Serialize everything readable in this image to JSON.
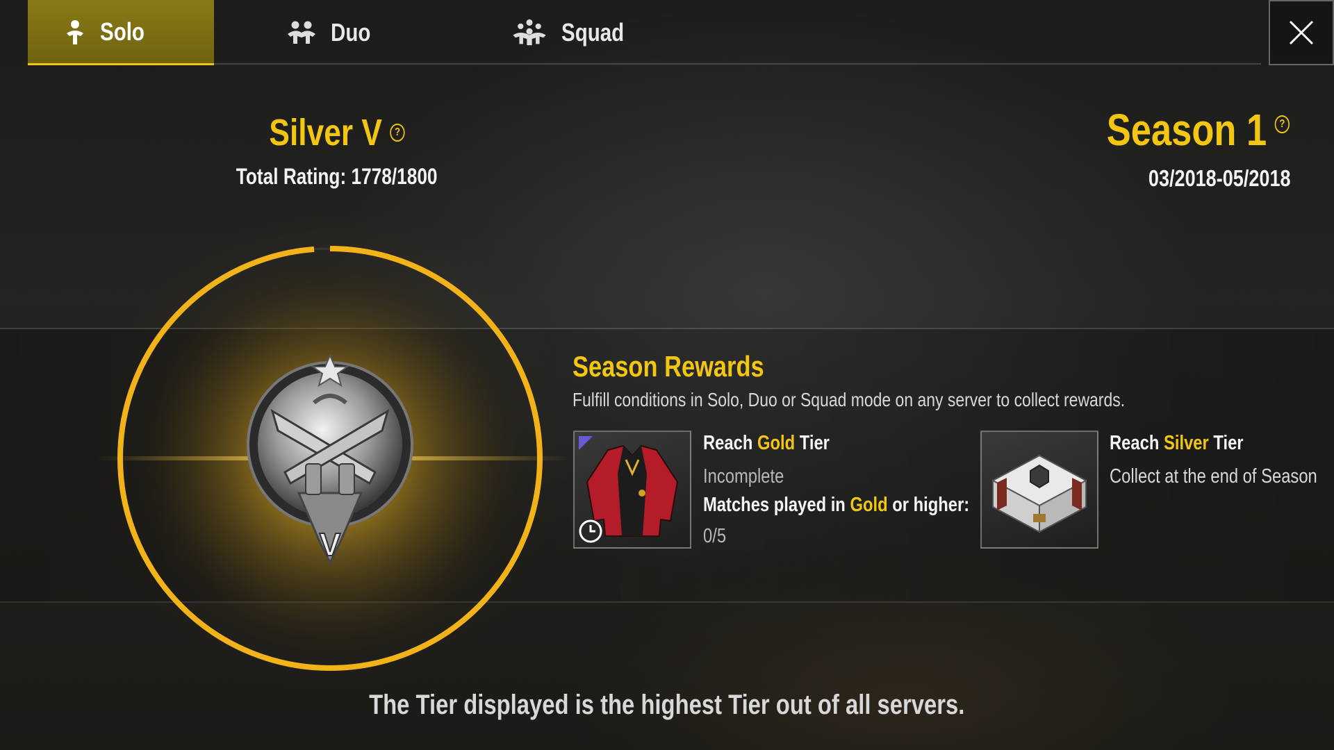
{
  "tabs": [
    {
      "label": "Solo",
      "icon": "solo-icon",
      "active": true
    },
    {
      "label": "Duo",
      "icon": "duo-icon",
      "active": false
    },
    {
      "label": "Squad",
      "icon": "squad-icon",
      "active": false
    }
  ],
  "close_icon": "close-icon",
  "tier": {
    "name": "Silver V",
    "help_glyph": "?",
    "rating_text": "Total Rating: 1778/1800",
    "rating_current": 1778,
    "rating_max": 1800,
    "badge_numeral": "V"
  },
  "season": {
    "title": "Season 1",
    "help_glyph": "?",
    "dates": "03/2018-05/2018"
  },
  "rewards": {
    "title": "Season Rewards",
    "description": "Fulfill conditions in Solo, Duo or Squad mode on any server to collect rewards.",
    "items": [
      {
        "thumb_icon": "jacket-icon",
        "title_prefix": "Reach ",
        "title_highlight": "Gold",
        "title_suffix": " Tier",
        "status": "Incomplete",
        "condition_prefix": "Matches played in ",
        "condition_highlight": "Gold",
        "condition_suffix": " or higher:",
        "progress": "0/5"
      },
      {
        "thumb_icon": "crate-icon",
        "title_prefix": "Reach ",
        "title_highlight": "Silver",
        "title_suffix": " Tier",
        "status": "Collect at the end of Season"
      }
    ]
  },
  "footer_note": "The Tier displayed is the highest Tier out of all servers.",
  "colors": {
    "accent": "#f3c614",
    "tab_active_bg": "#7d6f13",
    "text": "#f2f2f2"
  }
}
